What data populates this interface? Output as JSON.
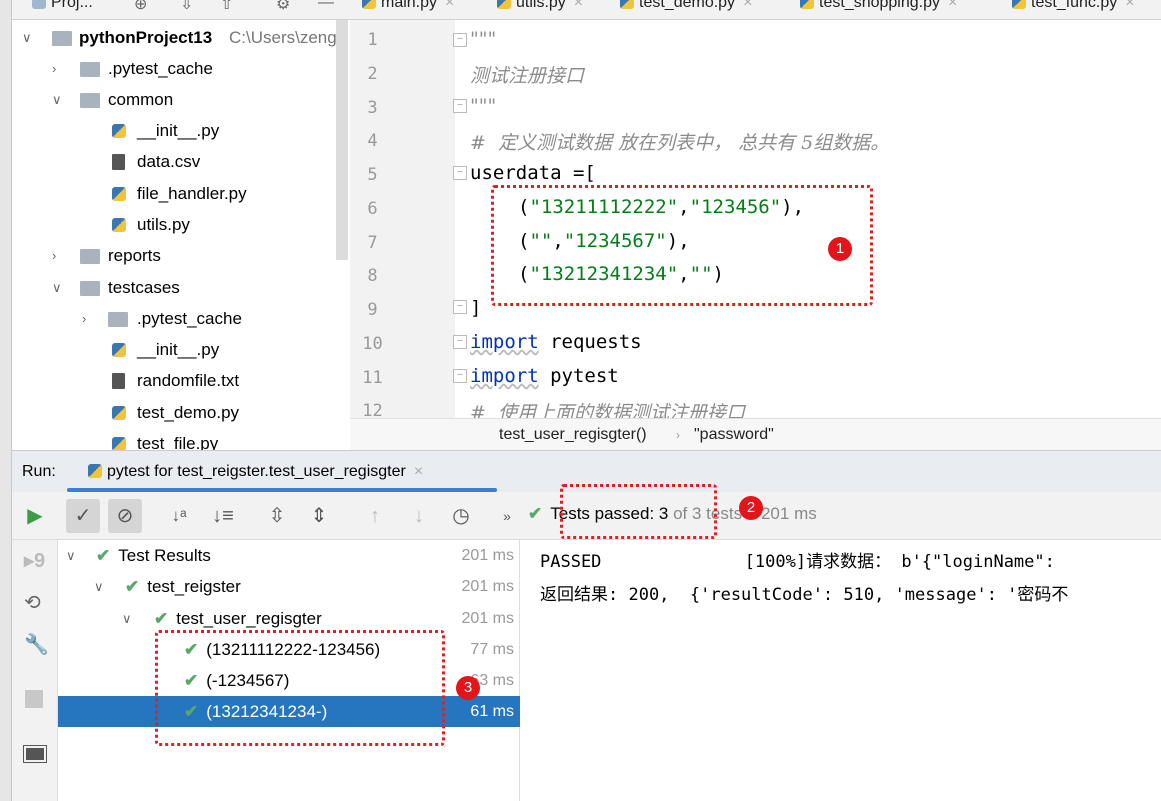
{
  "top_tabs": {
    "project_label": "Proj...",
    "files": [
      "main.py",
      "utils.py",
      "test_demo.py",
      "test_shopping.py",
      "test_func.py"
    ]
  },
  "project_tree": [
    {
      "label": "pythonProject13",
      "path": "C:\\Users\\zengy",
      "type": "root"
    },
    {
      "label": ".pytest_cache",
      "type": "folder"
    },
    {
      "label": "common",
      "type": "folder"
    },
    {
      "label": "__init__.py",
      "type": "py"
    },
    {
      "label": "data.csv",
      "type": "file"
    },
    {
      "label": "file_handler.py",
      "type": "py"
    },
    {
      "label": "utils.py",
      "type": "py"
    },
    {
      "label": "reports",
      "type": "folder"
    },
    {
      "label": "testcases",
      "type": "folder"
    },
    {
      "label": ".pytest_cache",
      "type": "folder"
    },
    {
      "label": "__init__.py",
      "type": "py"
    },
    {
      "label": "randomfile.txt",
      "type": "file"
    },
    {
      "label": "test_demo.py",
      "type": "py"
    },
    {
      "label": "test_file.py",
      "type": "py"
    }
  ],
  "editor": {
    "line_numbers": [
      "1",
      "2",
      "3",
      "4",
      "5",
      "6",
      "7",
      "8",
      "9",
      "10",
      "11",
      "12"
    ],
    "l1": "\"\"\"",
    "l2": "测试注册接口",
    "l3": "\"\"\"",
    "l4": "#  定义测试数据 放在列表中， 总共有 5组数据。",
    "l5": "userdata =[",
    "l6a": "(",
    "l6b": "\"13211112222\"",
    "l6c": ",",
    "l6d": "\"123456\"",
    "l6e": "),",
    "l7a": "(",
    "l7b": "\"\"",
    "l7c": ",",
    "l7d": "\"1234567\"",
    "l7e": "),",
    "l8a": "(",
    "l8b": "\"13212341234\"",
    "l8c": ",",
    "l8d": "\"\"",
    "l8e": ")",
    "l9": "]",
    "l10k": "import",
    "l10": " requests",
    "l11k": "import",
    "l11": " pytest",
    "l12": "#  使用上面的数据测试注册接口",
    "breadcrumb": [
      "test_user_regisgter()",
      "\"password\""
    ]
  },
  "run": {
    "label": "Run:",
    "tab": "pytest for test_reigster.test_user_regisgter",
    "status_passed": "Tests passed: 3",
    "status_of": " of 3 tests",
    "status_time": " – 201 ms"
  },
  "tree": [
    {
      "label": "Test Results",
      "time": "201 ms"
    },
    {
      "label": "test_reigster",
      "time": "201 ms"
    },
    {
      "label": "test_user_regisgter",
      "time": "201 ms"
    },
    {
      "label": "(13211112222-123456)",
      "time": "77 ms"
    },
    {
      "label": "(-1234567)",
      "time": "63 ms"
    },
    {
      "label": "(13212341234-)",
      "time": "61 ms",
      "selected": true
    }
  ],
  "output": [
    "PASSED              [100%]请求数据： b'{\"loginName\":",
    "返回结果: 200,  {'resultCode': 510, 'message': '密码不"
  ],
  "annotations": [
    "1",
    "2",
    "3"
  ],
  "colors": {
    "accent": "#2675bf",
    "pass": "#59a869",
    "annotation": "#e3141a",
    "string": "#067d17",
    "keyword": "#0033b3"
  }
}
